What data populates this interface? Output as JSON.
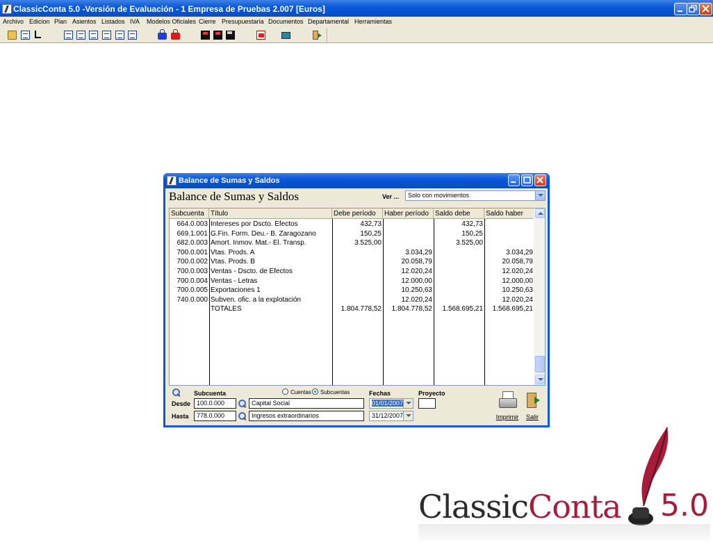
{
  "window": {
    "title": "ClassicConta 5.0 -Versión de Evaluación -     1 Empresa de Pruebas 2.007 [Euros]"
  },
  "menu": [
    "Archivo",
    "Edicion",
    "Plan",
    "Asientos",
    "Listados",
    "IVA",
    "Modelos Oficiales",
    "Cierre",
    "Presupuestaria",
    "Documentos",
    "Departamental",
    "Herramientas"
  ],
  "toolbar_icons": [
    "open-folder-icon",
    "ledger-icon",
    "account-tree-icon",
    "journal-d-icon",
    "journal-icon",
    "balance-b-icon",
    "sum-icon",
    "report-r-icon",
    "report-icon",
    "lock-blue-icon",
    "lock-red-icon",
    "save-red-icon",
    "save-red-2-icon",
    "save-icon",
    "pdf-icon",
    "monitor-icon",
    "exit-door-icon"
  ],
  "dialog": {
    "title": "Balance de Sumas y Saldos",
    "heading": "Balance de Sumas y Saldos",
    "ver_label": "Ver ...",
    "ver_value": "Solo con movimientos",
    "columns": [
      "Subcuenta",
      "Título",
      "Debe período",
      "Haber período",
      "Saldo debe",
      "Saldo haber"
    ],
    "rows": [
      [
        "664.0.003",
        "Intereses por Dscto. Efectos",
        "432,73",
        "",
        "432,73",
        ""
      ],
      [
        "669.1.001",
        "G.Fin. Form. Deu.- B. Zaragozano",
        "150,25",
        "",
        "150,25",
        ""
      ],
      [
        "682.0.003",
        "Amort. Inmov. Mat.- El. Transp.",
        "3.525,00",
        "",
        "3.525,00",
        ""
      ],
      [
        "700.0.001",
        "Vtas. Prods. A",
        "",
        "3.034,29",
        "",
        "3.034,29"
      ],
      [
        "700.0.002",
        "Vtas. Prods. B",
        "",
        "20.058,79",
        "",
        "20.058,79"
      ],
      [
        "700.0.003",
        "Ventas - Dscto. de Efectos",
        "",
        "12.020,24",
        "",
        "12.020,24"
      ],
      [
        "700.0.004",
        "Ventas - Letras",
        "",
        "12.000,00",
        "",
        "12.000,00"
      ],
      [
        "700.0.005",
        "Exportaciones 1",
        "",
        "10.250,63",
        "",
        "10.250,63"
      ],
      [
        "740.0.000",
        "Subven. ofic. a la explotación",
        "",
        "12.020,24",
        "",
        "12.020,24"
      ],
      [
        "",
        "TOTALES",
        "1.804.778,52",
        "1.804.778,52",
        "1.568.695,21",
        "1.568.695,21"
      ]
    ],
    "filter": {
      "subcuenta_label": "Subcuenta",
      "radio_cuentas": "Cuentas",
      "radio_subcuentas": "Subcuentas",
      "fechas_label": "Fechas",
      "proyecto_label": "Proyecto",
      "desde_label": "Desde",
      "hasta_label": "Hasta",
      "desde_code": "100.0.000",
      "desde_name": "Capital Social",
      "hasta_code": "778.0.000",
      "hasta_name": "Ingresos extraordinarios",
      "fecha_desde": "01/01/2007",
      "fecha_hasta": "31/12/2007",
      "proyecto": ""
    },
    "imprimir_label": "Imprimir",
    "salir_label": "Salir"
  },
  "logo": {
    "word1": "Classic",
    "word2": "Conta",
    "version": "5.0",
    "brand_color": "#a51d3a"
  }
}
